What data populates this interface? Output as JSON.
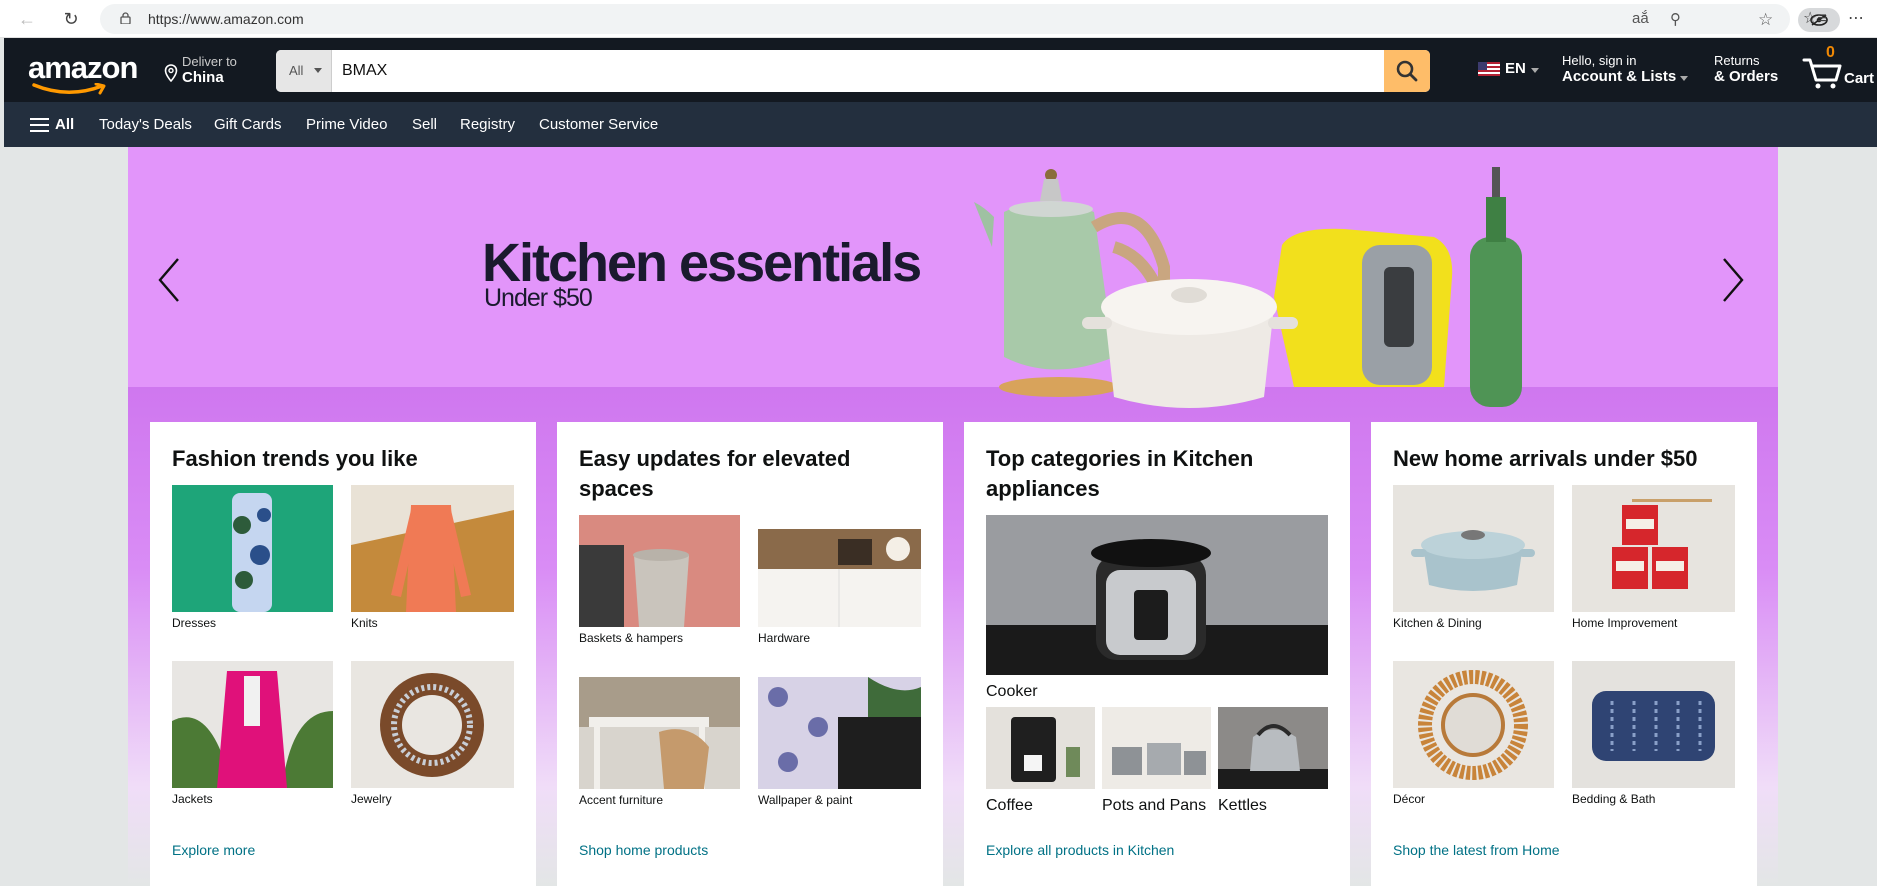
{
  "browser": {
    "url": "https://www.amazon.com"
  },
  "header": {
    "logo": "amazon",
    "deliver_label": "Deliver to",
    "deliver_location": "China",
    "search_category": "All",
    "search_value": "BMAX",
    "language": "EN",
    "account_greeting": "Hello, sign in",
    "account_label": "Account & Lists",
    "returns_label": "Returns",
    "orders_label": "& Orders",
    "cart_count": "0",
    "cart_label": "Cart"
  },
  "subnav": {
    "all_label": "All",
    "links": [
      "Today's Deals",
      "Gift Cards",
      "Prime Video",
      "Sell",
      "Registry",
      "Customer Service"
    ]
  },
  "hero": {
    "title": "Kitchen essentials",
    "subtitle": "Under $50"
  },
  "cards": [
    {
      "title": "Fashion trends you like",
      "tiles": [
        "Dresses",
        "Knits",
        "Jackets",
        "Jewelry"
      ],
      "link": "Explore more"
    },
    {
      "title": "Easy updates for elevated spaces",
      "tiles": [
        "Baskets & hampers",
        "Hardware",
        "Accent furniture",
        "Wallpaper & paint"
      ],
      "link": "Shop home products"
    },
    {
      "title": "Top categories in Kitchen appliances",
      "main_tile": "Cooker",
      "tiles": [
        "Coffee",
        "Pots and Pans",
        "Kettles"
      ],
      "link": "Explore all products in Kitchen"
    },
    {
      "title": "New home arrivals under $50",
      "tiles": [
        "Kitchen & Dining",
        "Home Improvement",
        "Décor",
        "Bedding & Bath"
      ],
      "link": "Shop the latest from Home"
    }
  ],
  "colors": {
    "header_bg": "#131921",
    "subnav_bg": "#232f3e",
    "search_button": "#febd69",
    "hero_bg": "#e295fa",
    "link": "#007185"
  }
}
